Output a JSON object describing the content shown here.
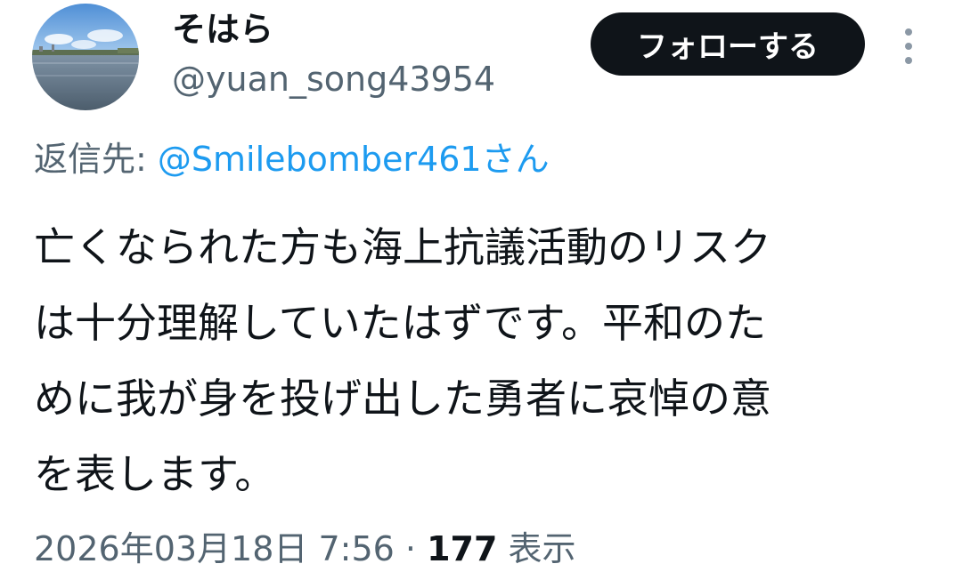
{
  "user": {
    "display_name": "そはら",
    "handle": "@yuan_song43954",
    "avatar_icon": "river-landscape-avatar"
  },
  "header": {
    "follow_label": "フォローする",
    "more_icon": "more-vertical-icon"
  },
  "reply": {
    "prefix": "返信先: ",
    "mention": "@Smilebomber461さん"
  },
  "tweet": {
    "lines": [
      "亡くなられた方も海上抗議活動のリスク",
      "は十分理解していたはずです。平和のた",
      "めに我が身を投げ出した勇者に哀悼の意",
      "を表します。"
    ]
  },
  "meta": {
    "timestamp": "2026年03月18日 7:56",
    "separator": " · ",
    "views_count": "177",
    "views_label": " 表示"
  },
  "colors": {
    "text_primary": "#0f1419",
    "text_secondary": "#536471",
    "link": "#1d9bf0",
    "button_bg": "#0f1419",
    "button_text": "#ffffff"
  }
}
